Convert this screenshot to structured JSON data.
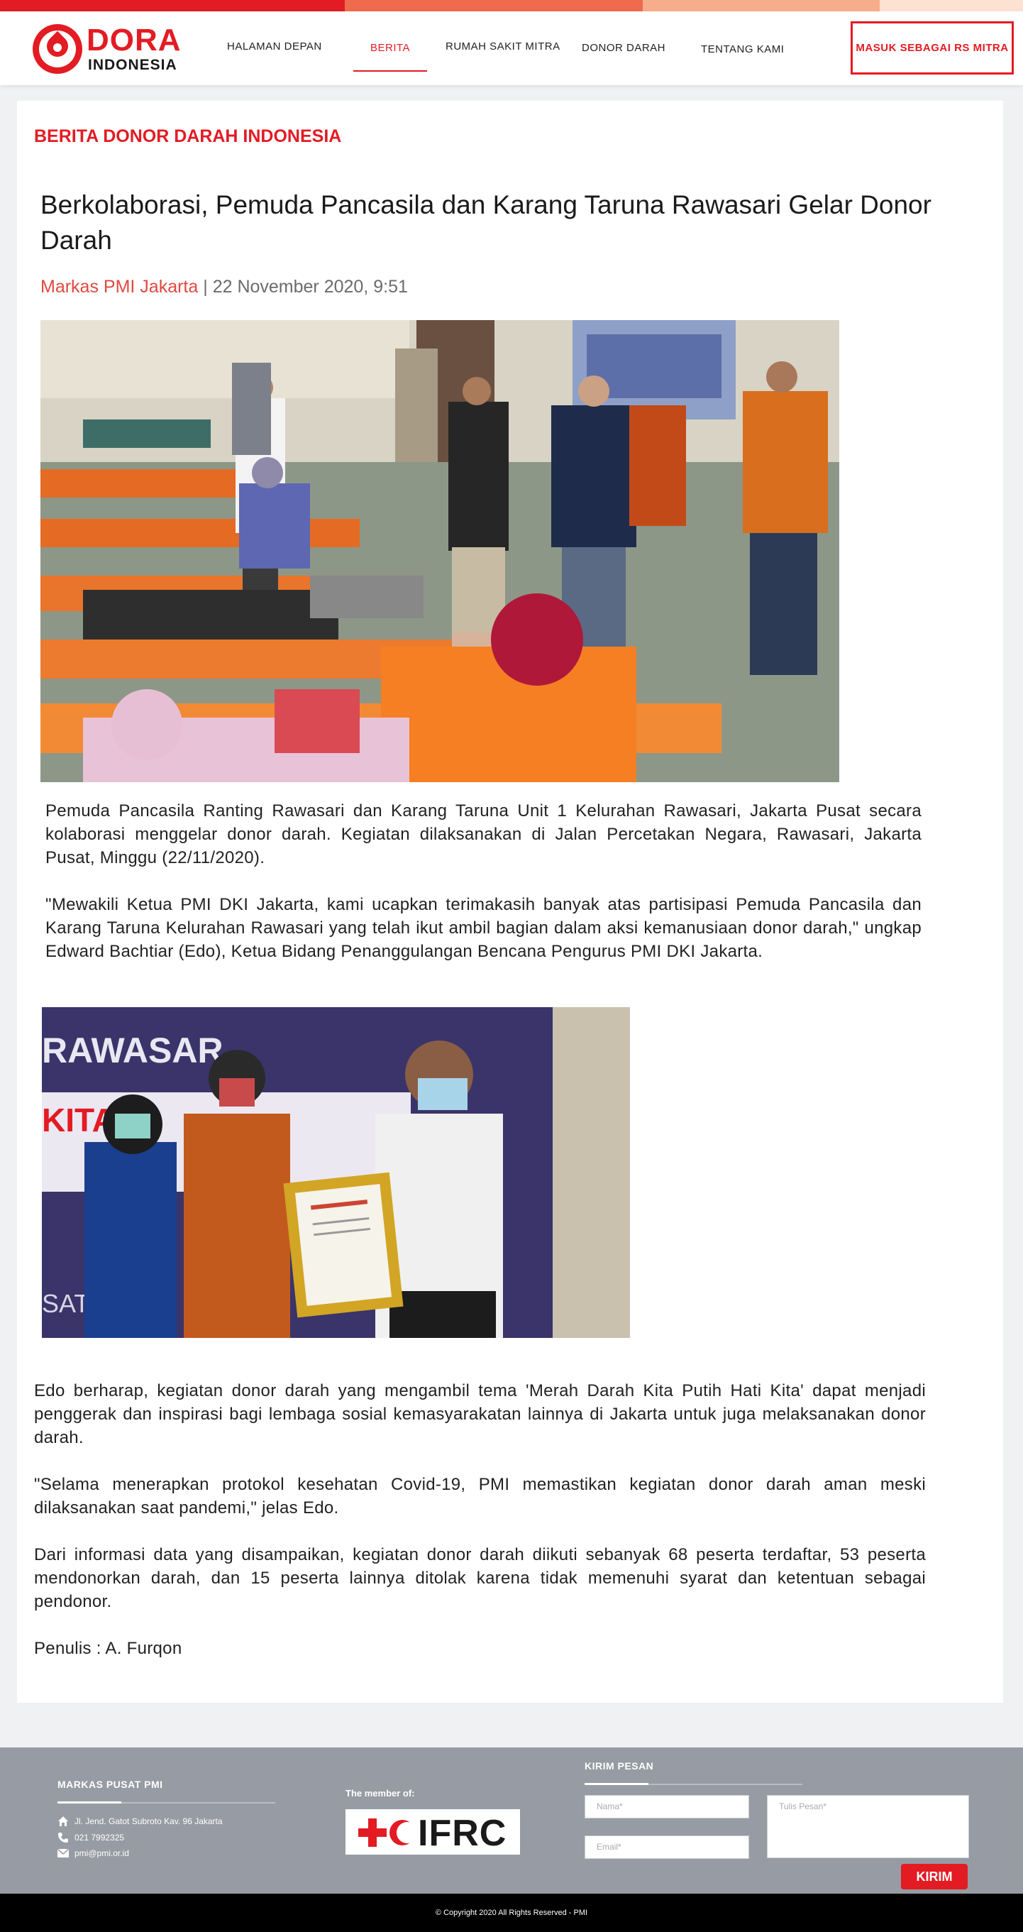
{
  "colors": {
    "brand_red": "#e31b23",
    "topbar": [
      "#e31b23",
      "#f06a4d",
      "#f7ad8c",
      "#fde1d3"
    ]
  },
  "logo": {
    "title": "DORA",
    "subtitle": "INDONESIA"
  },
  "nav": {
    "items": [
      {
        "label": "HALAMAN DEPAN"
      },
      {
        "label": "BERITA"
      },
      {
        "label": "RUMAH SAKIT MITRA"
      },
      {
        "label": "DONOR DARAH"
      },
      {
        "label": "TENTANG KAMI"
      }
    ],
    "active": "BERITA",
    "cta_label": "MASUK SEBAGAI RS MITRA"
  },
  "main": {
    "section_title": "BERITA DONOR DARAH INDONESIA",
    "article": {
      "title": "Berkolaborasi, Pemuda Pancasila dan Karang Taruna Rawasari Gelar Donor Darah",
      "author": "Markas PMI Jakarta",
      "separator": "|",
      "date": "22 November 2020, 9:51",
      "paragraphs_top": [
        "Pemuda Pancasila Ranting Rawasari dan Karang Taruna Unit 1 Kelurahan Rawasari, Jakarta Pusat secara kolaborasi menggelar donor darah. Kegiatan dilaksanakan di Jalan Percetakan Negara, Rawasari, Jakarta Pusat, Minggu (22/11/2020).",
        "\"Mewakili Ketua PMI DKI Jakarta, kami ucapkan terimakasih banyak atas partisipasi Pemuda Pancasila dan Karang Taruna Kelurahan Rawasari yang telah ikut ambil bagian dalam aksi kemanusiaan donor darah,\" ungkap Edward Bachtiar (Edo), Ketua Bidang Penanggulangan Bencana Pengurus PMI DKI Jakarta."
      ],
      "paragraphs_bottom": [
        "Edo berharap, kegiatan donor darah yang mengambil tema 'Merah Darah Kita Putih Hati Kita' dapat menjadi penggerak dan inspirasi bagi lembaga sosial kemasyarakatan lainnya di Jakarta untuk juga melaksanakan donor darah.",
        "\"Selama menerapkan protokol kesehatan Covid-19, PMI memastikan kegiatan donor darah aman meski dilaksanakan saat pandemi,\" jelas Edo.",
        "Dari informasi data yang disampaikan, kegiatan donor darah diikuti sebanyak 68 peserta terdaftar, 53 peserta mendonorkan darah, dan 15 peserta lainnya ditolak karena tidak memenuhi syarat dan ketentuan sebagai pendonor.",
        "Penulis : A. Furqon"
      ],
      "photo2_banner_text": "RAWASAR",
      "photo2_banner_text2": "KITA",
      "photo2_banner_text3": "SAT"
    }
  },
  "footer": {
    "address_heading": "MARKAS PUSAT PMI",
    "address": "Jl. Jend. Gatot Subroto Kav. 96 Jakarta",
    "phone": "021 7992325",
    "email": "pmi@pmi.or.id",
    "member_label": "The member of:",
    "member_logo_text": "IFRC",
    "contact_heading": "KIRIM PESAN",
    "name_placeholder": "Nama*",
    "email_placeholder": "Email*",
    "message_placeholder": "Tulis Pesan*",
    "send_label": "KIRIM",
    "copyright": "© Copyright 2020 All Rights Reserved - PMI"
  }
}
